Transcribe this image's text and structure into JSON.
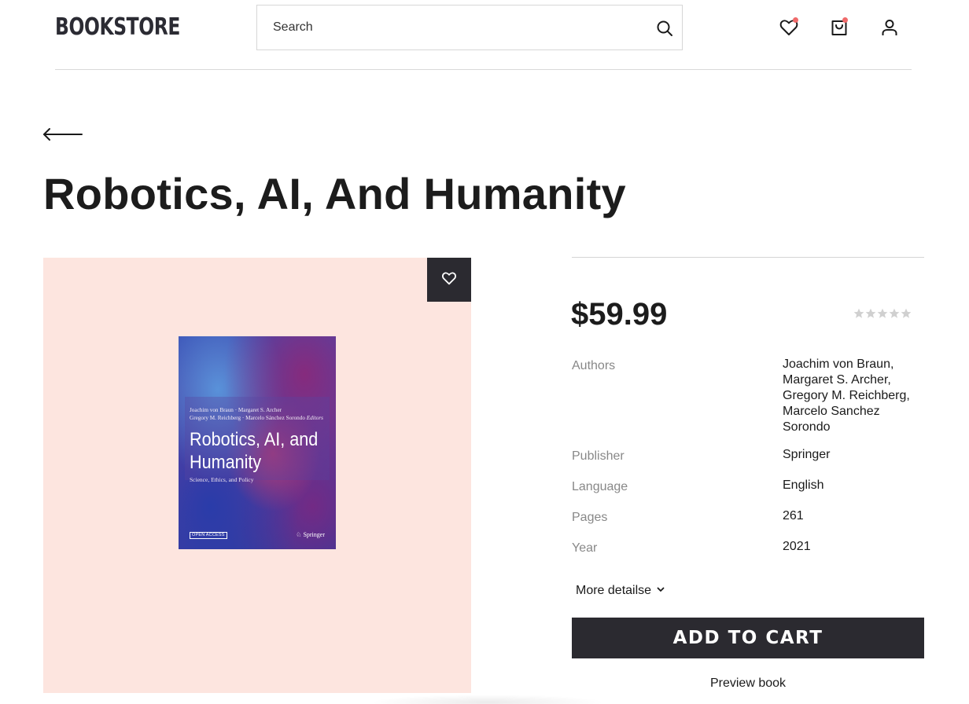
{
  "header": {
    "logo": "BOOKSTORE",
    "search_placeholder": "Search",
    "icons": [
      "search-icon",
      "heart-icon",
      "bag-icon",
      "user-icon"
    ],
    "notification_dot_color": "#f06a6a"
  },
  "book": {
    "title": "Robotics, AI, And Humanity",
    "price": "$59.99",
    "rating": {
      "value": 0,
      "max": 5
    },
    "details": [
      {
        "label": "Authors",
        "value": "Joachim von Braun, Margaret S. Archer, Gregory M. Reichberg, Marcelo Sanchez Sorondo"
      },
      {
        "label": "Publisher",
        "value": "Springer"
      },
      {
        "label": "Language",
        "value": "English"
      },
      {
        "label": "Pages",
        "value": "261"
      },
      {
        "label": "Year",
        "value": "2021"
      }
    ],
    "more_details_label": "More detailse",
    "add_to_cart_label": "ADD TO CART",
    "preview_label": "Preview book"
  },
  "cover": {
    "editors_line1": "Joachim von Braun · Margaret S. Archer",
    "editors_line2": "Gregory M. Reichberg · Marcelo Sánchez Sorondo",
    "editors_suffix": "Editors",
    "title_line1": "Robotics, AI, and",
    "title_line2": "Humanity",
    "subtitle": "Science, Ethics, and Policy",
    "badge": "OPEN ACCESS",
    "publisher": "Springer"
  },
  "colors": {
    "image_panel_bg": "#fde5df",
    "dark_button": "#2b2a30",
    "star_empty": "#d0d0d0"
  }
}
